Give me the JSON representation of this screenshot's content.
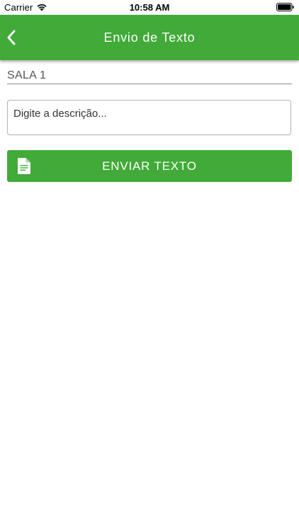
{
  "status_bar": {
    "carrier": "Carrier",
    "time": "10:58 AM",
    "wifi_icon": "wifi-icon",
    "battery_icon": "battery-icon"
  },
  "nav_bar": {
    "title": "Envio de Texto",
    "back_icon": "chevron-left-icon",
    "background_color": "#41aa38"
  },
  "form": {
    "room_name": "SALA 1",
    "description_value": "",
    "description_placeholder": "Digite a descrição..."
  },
  "send_button": {
    "label": "ENVIAR TEXTO",
    "icon": "document-icon",
    "color": "#41aa38"
  }
}
